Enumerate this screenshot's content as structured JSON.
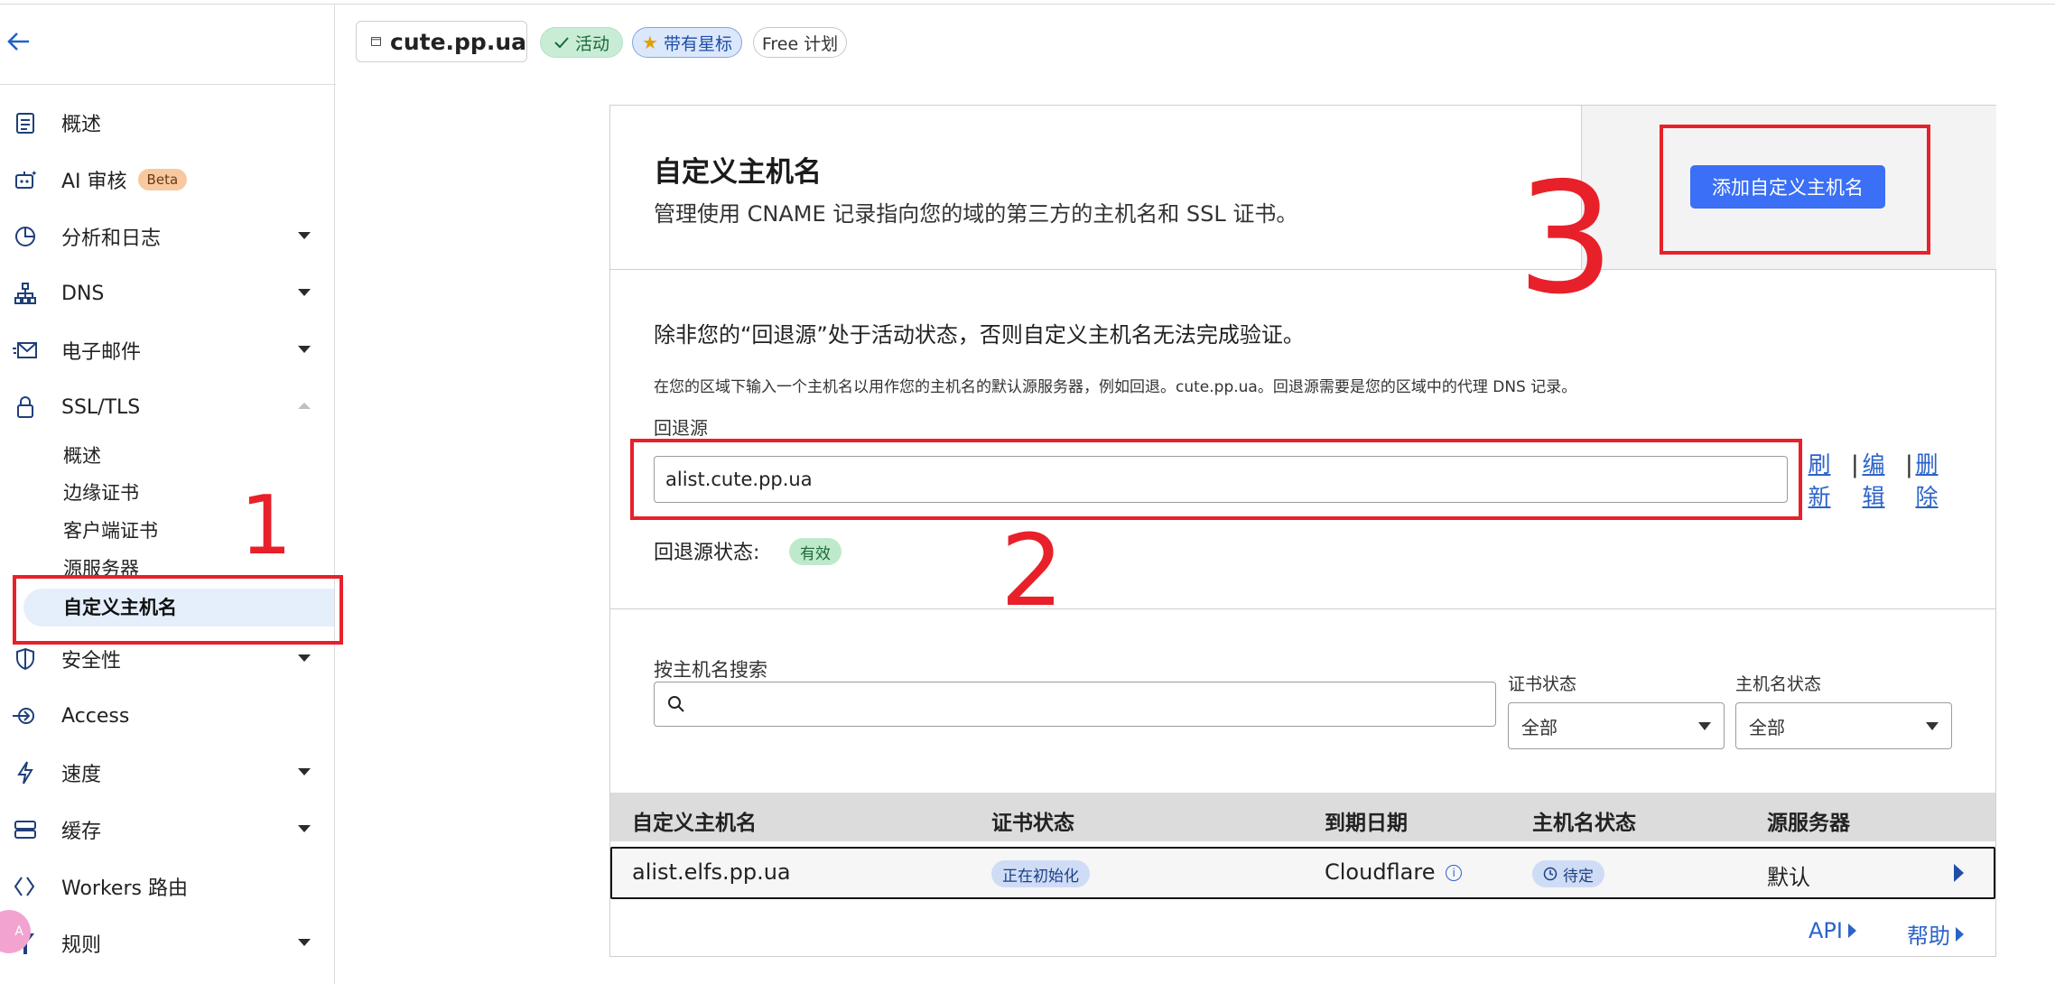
{
  "header": {
    "domain": "cute.pp.ua",
    "badge_active": "活动",
    "badge_starred": "带有星标",
    "badge_plan": "Free 计划"
  },
  "sidebar": {
    "items": [
      {
        "label": "概述",
        "icon": "clipboard-icon"
      },
      {
        "label": "AI 审核",
        "icon": "robot-icon",
        "badge": "Beta"
      },
      {
        "label": "分析和日志",
        "icon": "chart-pie-icon"
      },
      {
        "label": "DNS",
        "icon": "network-icon"
      },
      {
        "label": "电子邮件",
        "icon": "mail-icon"
      },
      {
        "label": "SSL/TLS",
        "icon": "lock-icon"
      },
      {
        "label": "安全性",
        "icon": "shield-icon"
      },
      {
        "label": "Access",
        "icon": "access-icon"
      },
      {
        "label": "速度",
        "icon": "lightning-icon"
      },
      {
        "label": "缓存",
        "icon": "storage-icon"
      },
      {
        "label": "Workers 路由",
        "icon": "workers-icon"
      },
      {
        "label": "规则",
        "icon": "rules-icon"
      }
    ],
    "ssl_sub": [
      "概述",
      "边缘证书",
      "客户端证书",
      "源服务器",
      "自定义主机名"
    ]
  },
  "main": {
    "title": "自定义主机名",
    "subtitle": "管理使用 CNAME 记录指向您的域的第三方的主机名和 SSL 证书。",
    "add_button": "添加自定义主机名",
    "warning": "除非您的“回退源”处于活动状态，否则自定义主机名无法完成验证。",
    "hint": "在您的区域下输入一个主机名以用作您的主机名的默认源服务器，例如回退。cute.pp.ua。回退源需要是您的区域中的代理 DNS 记录。",
    "fallback_label": "回退源",
    "fallback_value": "alist.cute.pp.ua",
    "links": {
      "refresh": [
        "刷",
        "新"
      ],
      "edit": [
        "编",
        "辑"
      ],
      "delete": [
        "删",
        "除"
      ]
    },
    "fallback_status_label": "回退源状态:",
    "fallback_status": "有效",
    "search_label": "按主机名搜索",
    "cert_status_label": "证书状态",
    "host_status_label": "主机名状态",
    "cert_status_value": "全部",
    "host_status_value": "全部",
    "table": {
      "headers": [
        "自定义主机名",
        "证书状态",
        "到期日期",
        "主机名状态",
        "源服务器"
      ],
      "rows": [
        {
          "hostname": "alist.elfs.pp.ua",
          "cert": "正在初始化",
          "expiry": "Cloudflare",
          "host_status": "待定",
          "origin": "默认"
        }
      ]
    },
    "footer": {
      "api": "API",
      "help": "帮助"
    }
  },
  "annotations": [
    "1",
    "2",
    "3"
  ],
  "colors": {
    "accent": "#3b6ff5",
    "annotation": "#e8202a",
    "active_green": "#c9ecd6"
  }
}
